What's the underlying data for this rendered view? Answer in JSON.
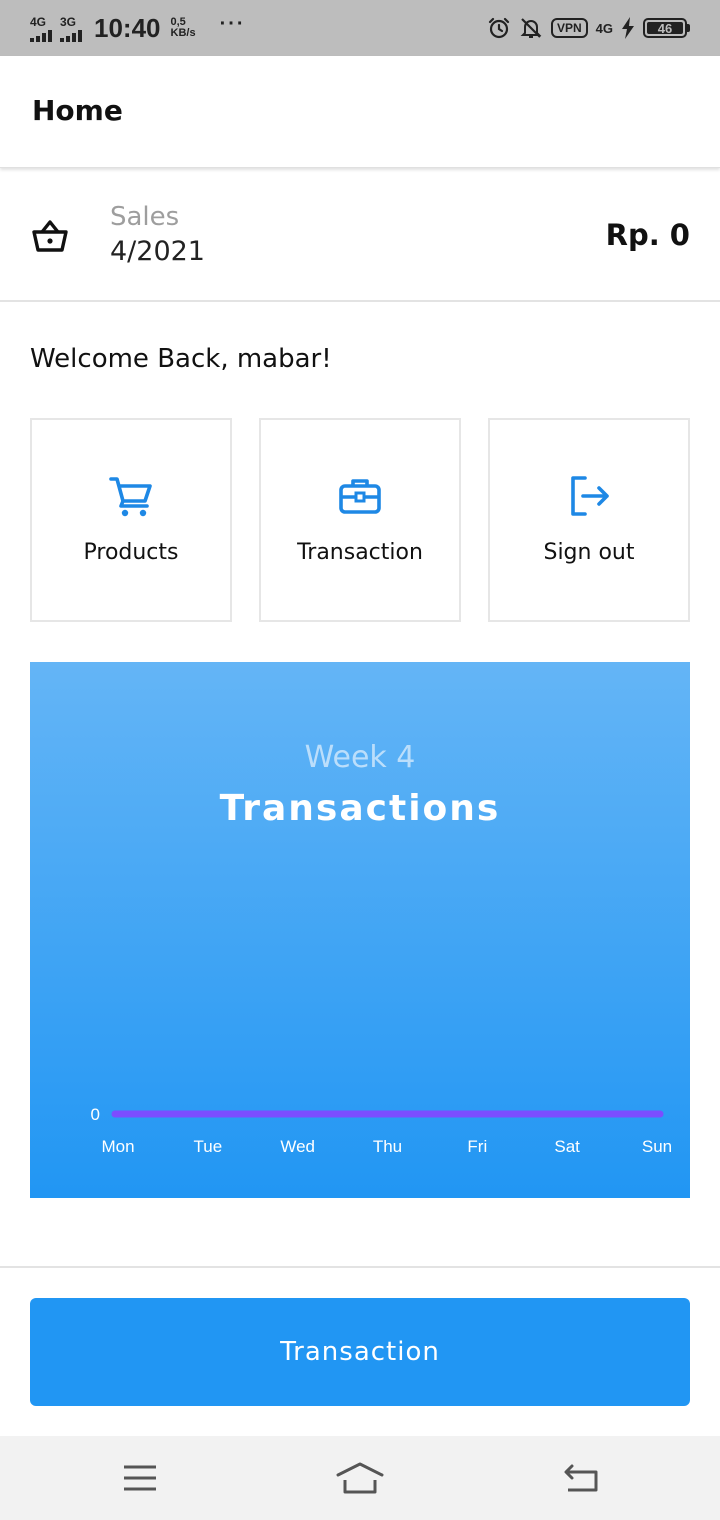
{
  "status_bar": {
    "sim1_network": "4G",
    "sim2_network": "3G",
    "time": "10:40",
    "speed_value": "0,5",
    "speed_unit": "KB/s",
    "more": "···",
    "vpn": "VPN",
    "data_network": "4G",
    "battery_level": "46"
  },
  "app_bar": {
    "title": "Home"
  },
  "sales": {
    "label": "Sales",
    "period": "4/2021",
    "amount": "Rp. 0"
  },
  "welcome": "Welcome Back, mabar!",
  "menu": [
    {
      "label": "Products",
      "icon": "cart-icon"
    },
    {
      "label": "Transaction",
      "icon": "briefcase-icon"
    },
    {
      "label": "Sign out",
      "icon": "sign-out-icon"
    }
  ],
  "chart_data": {
    "type": "line",
    "subtitle": "Week 4",
    "title": "Transactions",
    "categories": [
      "Mon",
      "Tue",
      "Wed",
      "Thu",
      "Fri",
      "Sat",
      "Sun"
    ],
    "series": [
      {
        "values": [
          0,
          0,
          0,
          0,
          0,
          0,
          0
        ],
        "color": "#7c4dff"
      }
    ],
    "y_tick_labels": [
      "0"
    ],
    "grid": false
  },
  "bottom_button": {
    "label": "Transaction"
  },
  "colors": {
    "accent": "#2196f3",
    "icon": "#1e88e5",
    "chart_top": "#64b5f6",
    "chart_bottom": "#2196f3",
    "line": "#7c4dff"
  },
  "nav_icons": [
    "menu-icon",
    "home-icon",
    "back-icon"
  ]
}
